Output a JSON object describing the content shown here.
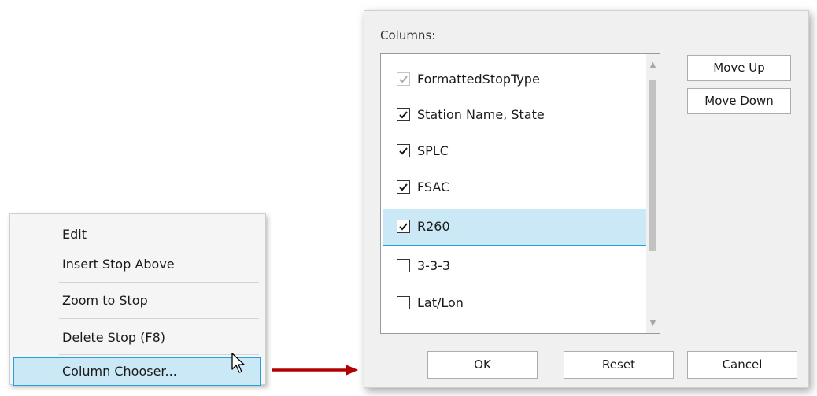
{
  "context_menu": {
    "items": [
      {
        "label": "Edit"
      },
      {
        "label": "Insert Stop Above"
      },
      {
        "label": "Zoom to Stop"
      },
      {
        "label": "Delete Stop (F8)"
      },
      {
        "label": "Column Chooser...",
        "selected": true
      }
    ]
  },
  "dialog": {
    "columns_label": "Columns:",
    "columns": [
      {
        "label": "FormattedStopType",
        "checked": true,
        "disabled": true
      },
      {
        "label": "Station Name, State",
        "checked": true
      },
      {
        "label": "SPLC",
        "checked": true
      },
      {
        "label": "FSAC",
        "checked": true
      },
      {
        "label": "R260",
        "checked": true,
        "selected": true
      },
      {
        "label": "3-3-3",
        "checked": false
      },
      {
        "label": "Lat/Lon",
        "checked": false
      }
    ],
    "move_up_label": "Move Up",
    "move_down_label": "Move Down",
    "ok_label": "OK",
    "reset_label": "Reset",
    "cancel_label": "Cancel"
  },
  "colors": {
    "selection_fill": "#cbe8f6",
    "selection_border": "#26a0da",
    "connector_arrow": "#b00000"
  },
  "icons": {
    "scroll_up": "scroll-up-arrow-icon",
    "scroll_down": "scroll-down-arrow-icon",
    "checkmark": "checkmark-icon",
    "cursor": "mouse-pointer-icon",
    "connector": "arrow-right-icon"
  }
}
